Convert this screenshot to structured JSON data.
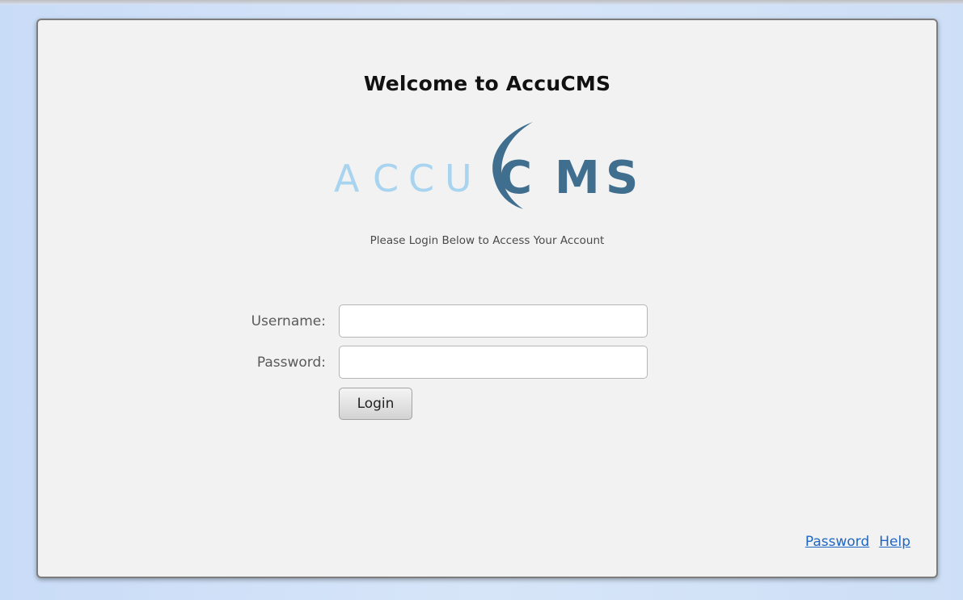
{
  "page": {
    "title": "Welcome to AccuCMS",
    "subtitle": "Please Login Below to Access Your Account"
  },
  "logo": {
    "letters_light": [
      "A",
      "C",
      "C",
      "U"
    ],
    "letters_dark": [
      "C",
      "M",
      "S"
    ],
    "color_light": "#a8d4ef",
    "color_dark": "#3f6e8f"
  },
  "form": {
    "username_label": "Username:",
    "username_value": "",
    "password_label": "Password:",
    "password_value": "",
    "login_label": "Login"
  },
  "footer": {
    "password_link": "Password",
    "help_link": "Help"
  }
}
